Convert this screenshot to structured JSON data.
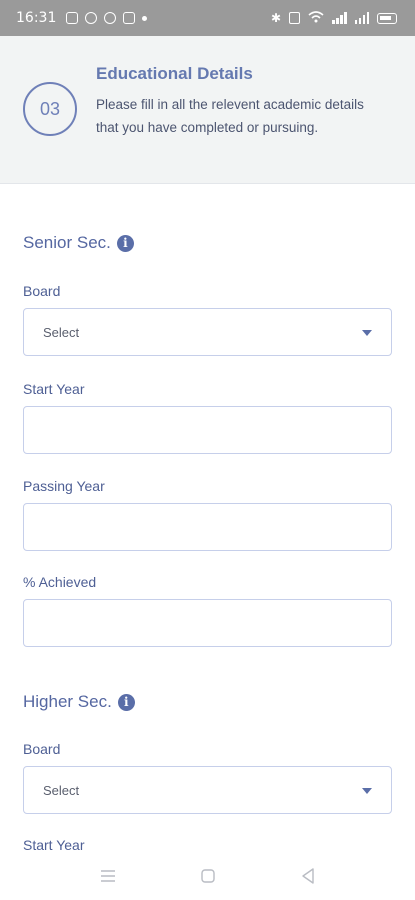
{
  "status_bar": {
    "time": "16:31",
    "icons_left": [
      "notification-icon",
      "app-icon",
      "app-icon",
      "screenshot-icon",
      "dot-icon"
    ],
    "icons_right": [
      "bluetooth-icon",
      "nfc-icon",
      "wifi-icon",
      "signal-icon",
      "signal-icon",
      "battery-icon"
    ]
  },
  "header": {
    "step": "03",
    "title": "Educational Details",
    "description": "Please fill in all the relevent academic details that you have completed or pursuing."
  },
  "senior": {
    "title": "Senior Sec.",
    "board_label": "Board",
    "board_value": "Select",
    "start_year_label": "Start Year",
    "start_year_value": "",
    "passing_year_label": "Passing Year",
    "passing_year_value": "",
    "achieved_label": "% Achieved",
    "achieved_value": ""
  },
  "higher": {
    "title": "Higher Sec.",
    "board_label": "Board",
    "board_value": "Select",
    "start_year_label": "Start Year"
  },
  "nav": [
    "menu-icon",
    "home-icon",
    "back-icon"
  ],
  "colors": {
    "accent": "#5a6ea8",
    "field_border": "#c6cfea",
    "header_bg": "#f2f4f4",
    "status_bar_bg": "#9a9a9a"
  }
}
